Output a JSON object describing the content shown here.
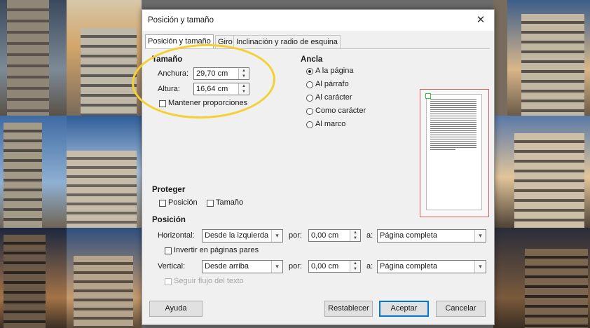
{
  "dialog": {
    "title": "Posición y tamaño",
    "close_glyph": "✕",
    "tabs": [
      {
        "label": "Posición y tamaño",
        "active": true
      },
      {
        "label": "Giro",
        "active": false
      },
      {
        "label": "Inclinación y radio de esquina",
        "active": false
      }
    ]
  },
  "size": {
    "header": "Tamaño",
    "width_label": "Anchura:",
    "width_value": "29,70 cm",
    "height_label": "Altura:",
    "height_value": "16,64 cm",
    "keep_ratio_label": "Mantener proporciones",
    "keep_ratio_checked": false
  },
  "anchor": {
    "header": "Ancla",
    "options": [
      {
        "label": "A la página",
        "selected": true
      },
      {
        "label": "Al párrafo",
        "selected": false
      },
      {
        "label": "Al carácter",
        "selected": false
      },
      {
        "label": "Como carácter",
        "selected": false
      },
      {
        "label": "Al marco",
        "selected": false
      }
    ]
  },
  "protect": {
    "header": "Proteger",
    "position_label": "Posición",
    "size_label": "Tamaño"
  },
  "position": {
    "header": "Posición",
    "horizontal_label": "Horizontal:",
    "horizontal_value": "Desde la izquierda",
    "by_label": "por:",
    "horizontal_by": "0,00 cm",
    "to_label": "a:",
    "horizontal_to": "Página completa",
    "mirror_label": "Invertir en páginas pares",
    "vertical_label": "Vertical:",
    "vertical_value": "Desde arriba",
    "vertical_by": "0,00 cm",
    "vertical_to": "Página completa",
    "follow_flow_label": "Seguir flujo del texto"
  },
  "buttons": {
    "help": "Ayuda",
    "reset": "Restablecer",
    "accept": "Aceptar",
    "cancel": "Cancelar"
  },
  "colors": {
    "highlight": "#f4d032",
    "preview_border": "#e06060",
    "accent": "#0078d7"
  }
}
